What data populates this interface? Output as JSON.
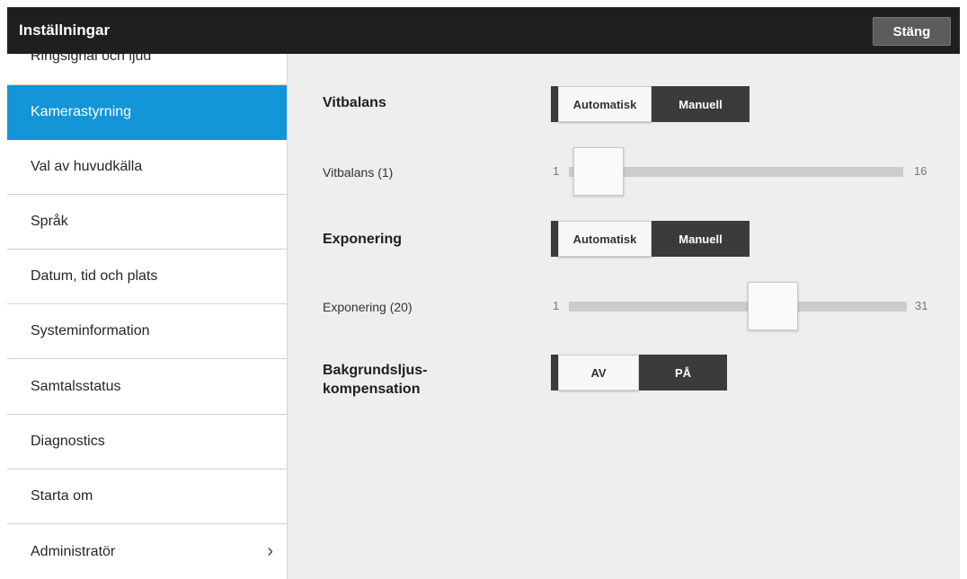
{
  "header": {
    "title": "Inställningar",
    "close_label": "Stäng"
  },
  "sidebar": {
    "items": [
      {
        "label": "Ringsignal och ljud"
      },
      {
        "label": "Kamerastyrning",
        "active": true
      },
      {
        "label": "Val av huvudkälla"
      },
      {
        "label": "Språk"
      },
      {
        "label": "Datum, tid och plats"
      },
      {
        "label": "Systeminformation"
      },
      {
        "label": "Samtalsstatus"
      },
      {
        "label": "Diagnostics"
      },
      {
        "label": "Starta om"
      },
      {
        "label": "Administratör",
        "chevron": "chevron-right-icon"
      }
    ]
  },
  "camera": {
    "white_balance": {
      "label": "Vitbalans",
      "options": [
        "Automatisk",
        "Manuell"
      ],
      "selected": "Automatisk",
      "slider": {
        "label": "Vitbalans (1)",
        "min": "1",
        "max": "16",
        "value": 1
      }
    },
    "exposure": {
      "label": "Exponering",
      "options": [
        "Automatisk",
        "Manuell"
      ],
      "selected": "Automatisk",
      "slider": {
        "label": "Exponering (20)",
        "min": "1",
        "max": "31",
        "value": 20
      }
    },
    "backlight": {
      "label_line1": "Bakgrundsljus-",
      "label_line2": "kompensation",
      "options": [
        "AV",
        "PÅ"
      ],
      "selected": "AV"
    }
  },
  "colors": {
    "accent": "#1495d8",
    "header_bg": "#1f1f1f",
    "segment_bg": "#3b3b3b"
  }
}
